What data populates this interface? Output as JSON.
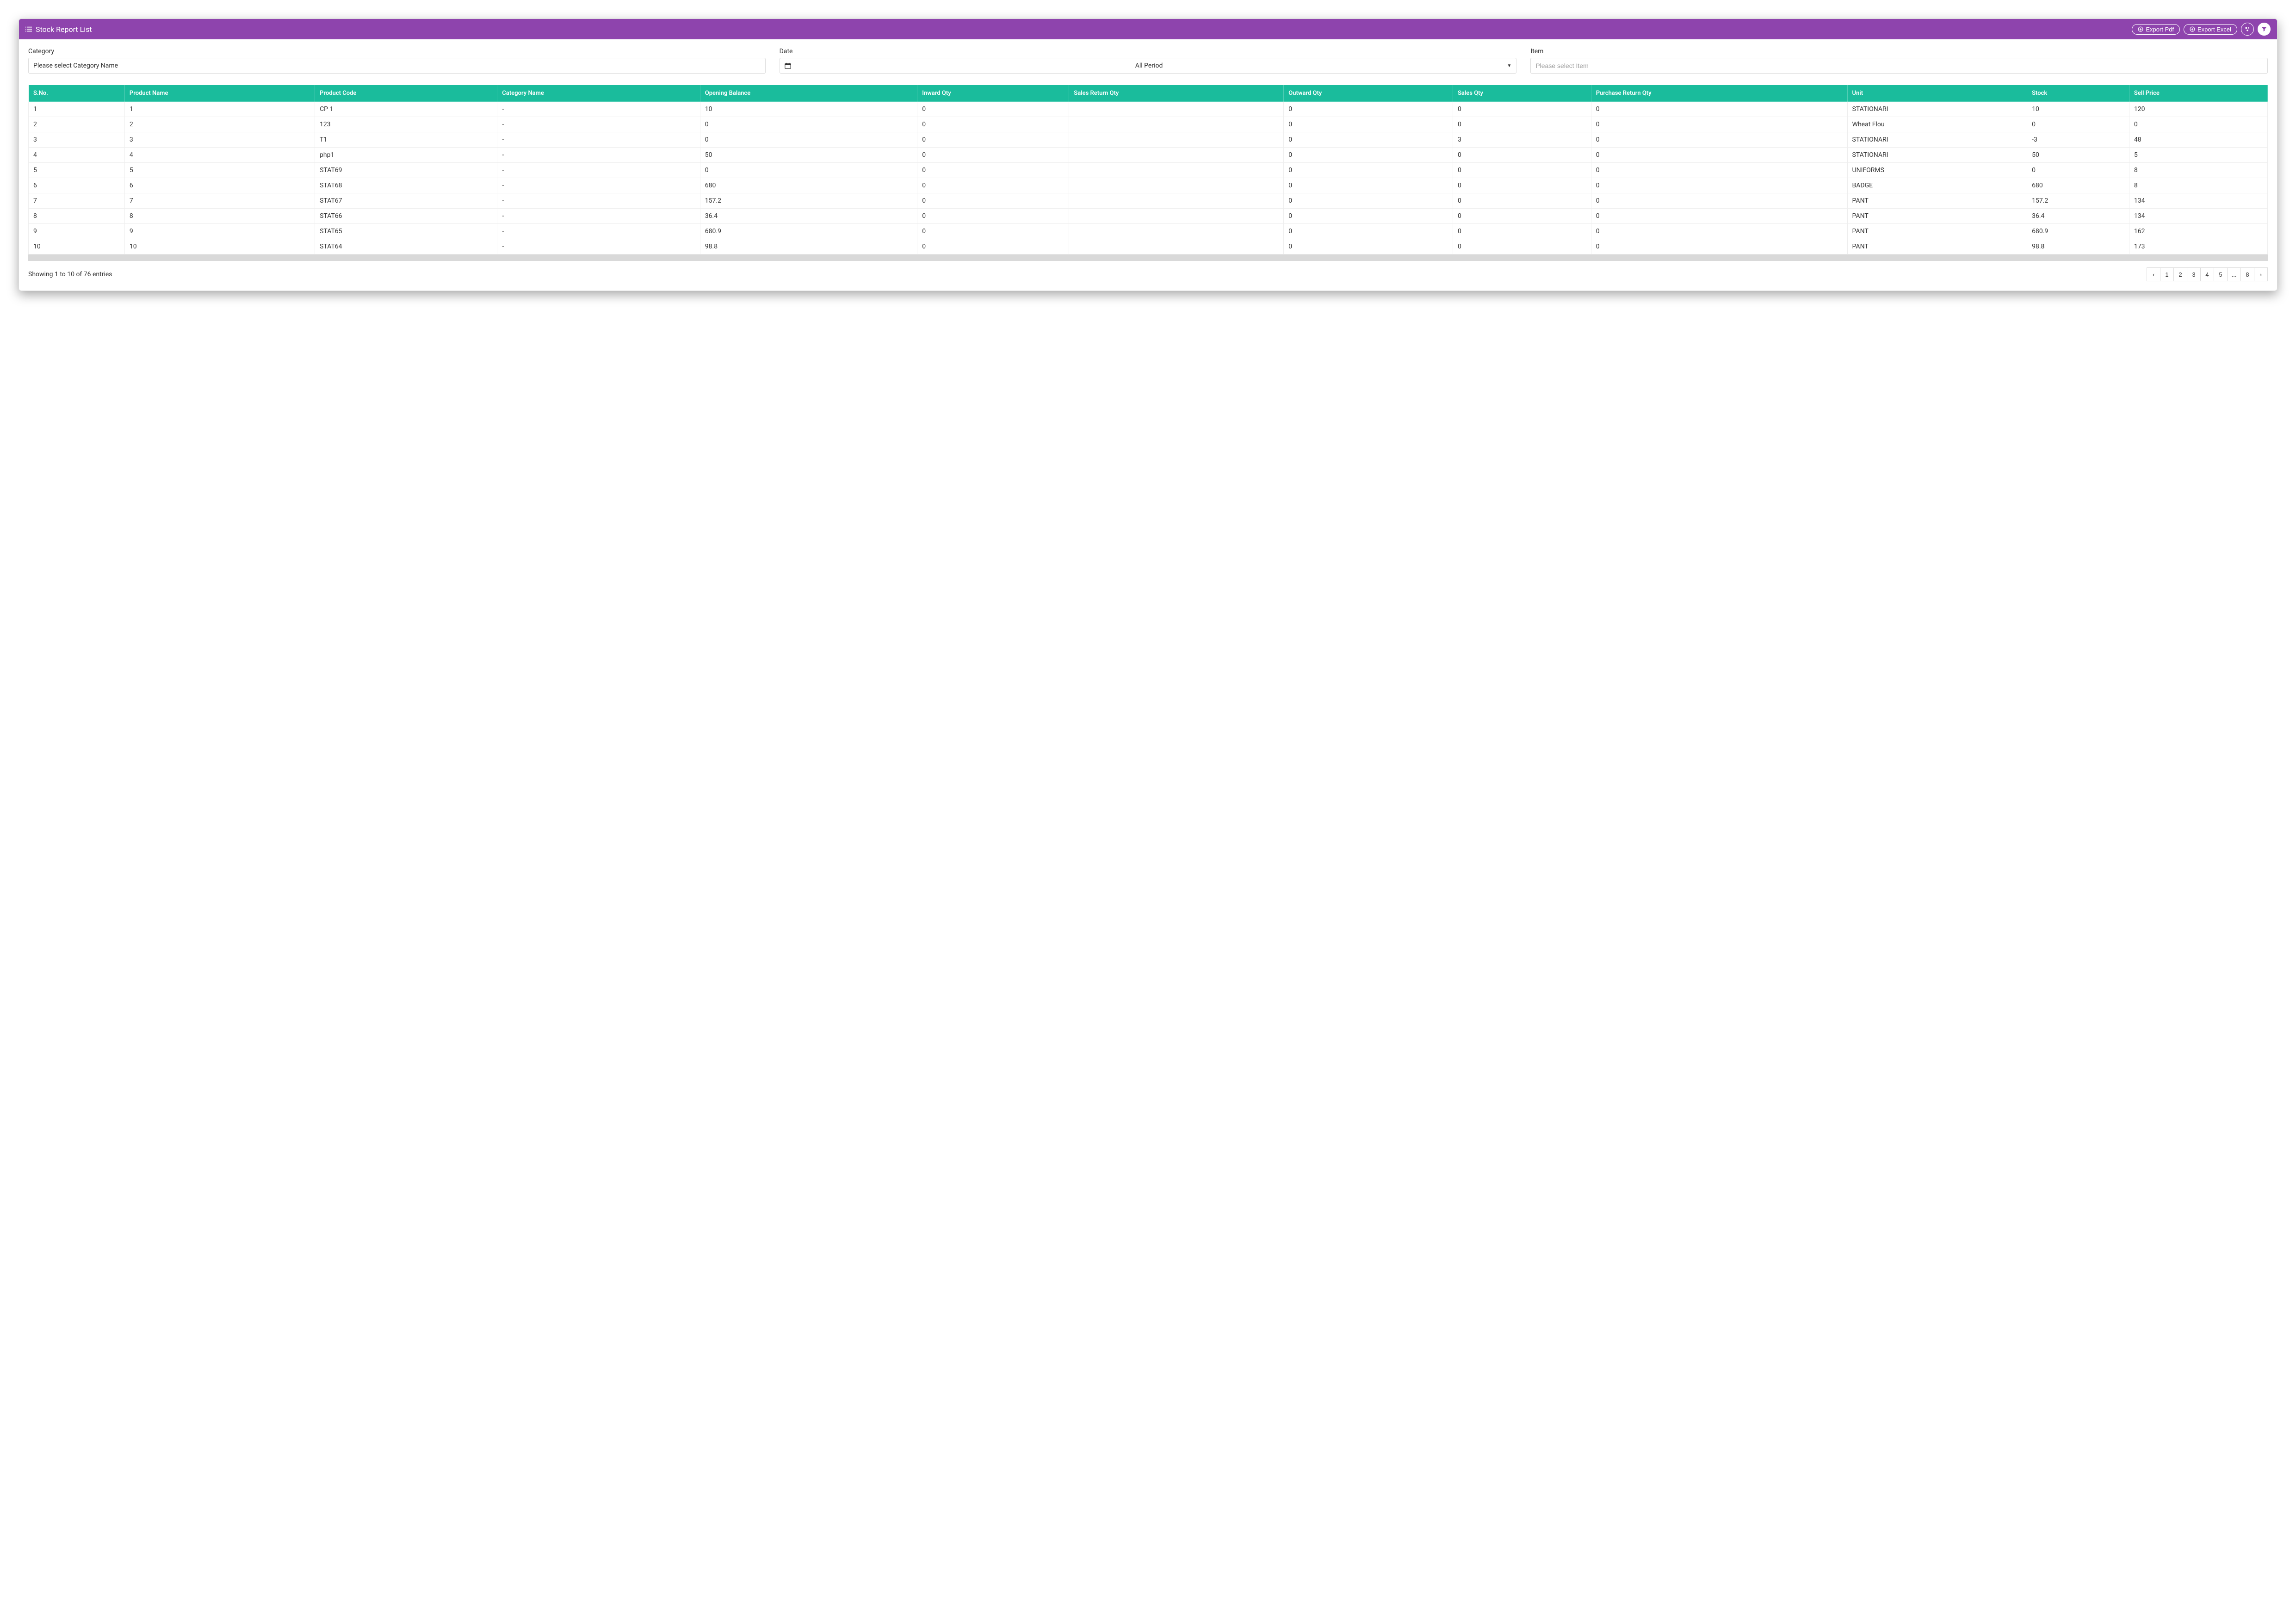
{
  "header": {
    "title": "Stock Report List",
    "export_pdf": "Export Pdf",
    "export_excel": "Export Excel"
  },
  "filters": {
    "category_label": "Category",
    "category_value": "Please select Category Name",
    "date_label": "Date",
    "date_value": "All Period",
    "item_label": "Item",
    "item_placeholder": "Please select Item"
  },
  "columns": [
    "S.No.",
    "Product Name",
    "Product Code",
    "Category Name",
    "Opening Balance",
    "Inward Qty",
    "Sales Return Qty",
    "Outward Qty",
    "Sales Qty",
    "Purchase Return Qty",
    "Unit",
    "Stock",
    "Sell Price"
  ],
  "rows": [
    {
      "sno": "1",
      "pname": "1",
      "pcode": "CP 1",
      "cat": "-",
      "open": "10",
      "inq": "0",
      "srq": "",
      "outq": "0",
      "sq": "0",
      "prq": "0",
      "unit": "STATIONARI",
      "stock": "10",
      "price": "120"
    },
    {
      "sno": "2",
      "pname": "2",
      "pcode": "123",
      "cat": "-",
      "open": "0",
      "inq": "0",
      "srq": "",
      "outq": "0",
      "sq": "0",
      "prq": "0",
      "unit": "Wheat Flou",
      "stock": "0",
      "price": "0"
    },
    {
      "sno": "3",
      "pname": "3",
      "pcode": "T1",
      "cat": "-",
      "open": "0",
      "inq": "0",
      "srq": "",
      "outq": "0",
      "sq": "3",
      "prq": "0",
      "unit": "STATIONARI",
      "stock": "-3",
      "price": "48"
    },
    {
      "sno": "4",
      "pname": "4",
      "pcode": "php1",
      "cat": "-",
      "open": "50",
      "inq": "0",
      "srq": "",
      "outq": "0",
      "sq": "0",
      "prq": "0",
      "unit": "STATIONARI",
      "stock": "50",
      "price": "5"
    },
    {
      "sno": "5",
      "pname": "5",
      "pcode": "STAT69",
      "cat": "-",
      "open": "0",
      "inq": "0",
      "srq": "",
      "outq": "0",
      "sq": "0",
      "prq": "0",
      "unit": "UNIFORMS",
      "stock": "0",
      "price": "8"
    },
    {
      "sno": "6",
      "pname": "6",
      "pcode": "STAT68",
      "cat": "-",
      "open": "680",
      "inq": "0",
      "srq": "",
      "outq": "0",
      "sq": "0",
      "prq": "0",
      "unit": "BADGE",
      "stock": "680",
      "price": "8"
    },
    {
      "sno": "7",
      "pname": "7",
      "pcode": "STAT67",
      "cat": "-",
      "open": "157.2",
      "inq": "0",
      "srq": "",
      "outq": "0",
      "sq": "0",
      "prq": "0",
      "unit": "PANT",
      "stock": "157.2",
      "price": "134"
    },
    {
      "sno": "8",
      "pname": "8",
      "pcode": "STAT66",
      "cat": "-",
      "open": "36.4",
      "inq": "0",
      "srq": "",
      "outq": "0",
      "sq": "0",
      "prq": "0",
      "unit": "PANT",
      "stock": "36.4",
      "price": "134"
    },
    {
      "sno": "9",
      "pname": "9",
      "pcode": "STAT65",
      "cat": "-",
      "open": "680.9",
      "inq": "0",
      "srq": "",
      "outq": "0",
      "sq": "0",
      "prq": "0",
      "unit": "PANT",
      "stock": "680.9",
      "price": "162"
    },
    {
      "sno": "10",
      "pname": "10",
      "pcode": "STAT64",
      "cat": "-",
      "open": "98.8",
      "inq": "0",
      "srq": "",
      "outq": "0",
      "sq": "0",
      "prq": "0",
      "unit": "PANT",
      "stock": "98.8",
      "price": "173"
    }
  ],
  "footer": {
    "info": "Showing 1 to 10 of 76 entries",
    "pages": [
      "1",
      "2",
      "3",
      "4",
      "5",
      "...",
      "8"
    ]
  }
}
